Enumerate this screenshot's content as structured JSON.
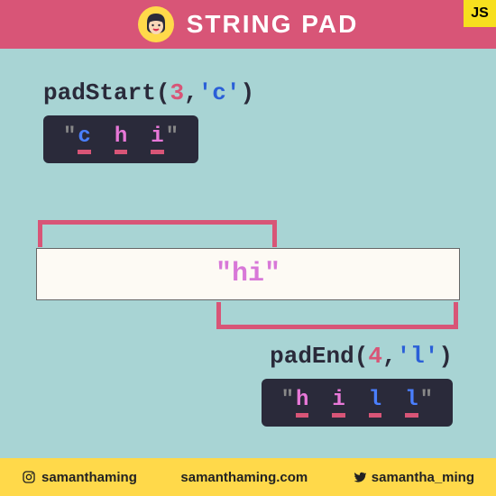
{
  "header": {
    "title": "STRING PAD",
    "badge": "JS"
  },
  "padStart": {
    "fn": "padStart",
    "arg_num": "3",
    "arg_str": "'c'",
    "result_chars": [
      {
        "ch": "c",
        "cls": "c-blue"
      },
      {
        "ch": "h",
        "cls": "c-pink"
      },
      {
        "ch": "i",
        "cls": "c-pink"
      }
    ]
  },
  "center": {
    "text": "hi"
  },
  "padEnd": {
    "fn": "padEnd",
    "arg_num": "4",
    "arg_str": "'l'",
    "result_chars": [
      {
        "ch": "h",
        "cls": "c-pink"
      },
      {
        "ch": "i",
        "cls": "c-pink"
      },
      {
        "ch": "l",
        "cls": "c-blue"
      },
      {
        "ch": "l",
        "cls": "c-blue"
      }
    ]
  },
  "footer": {
    "instagram": "samanthaming",
    "website": "samanthaming.com",
    "twitter": "samantha_ming"
  }
}
